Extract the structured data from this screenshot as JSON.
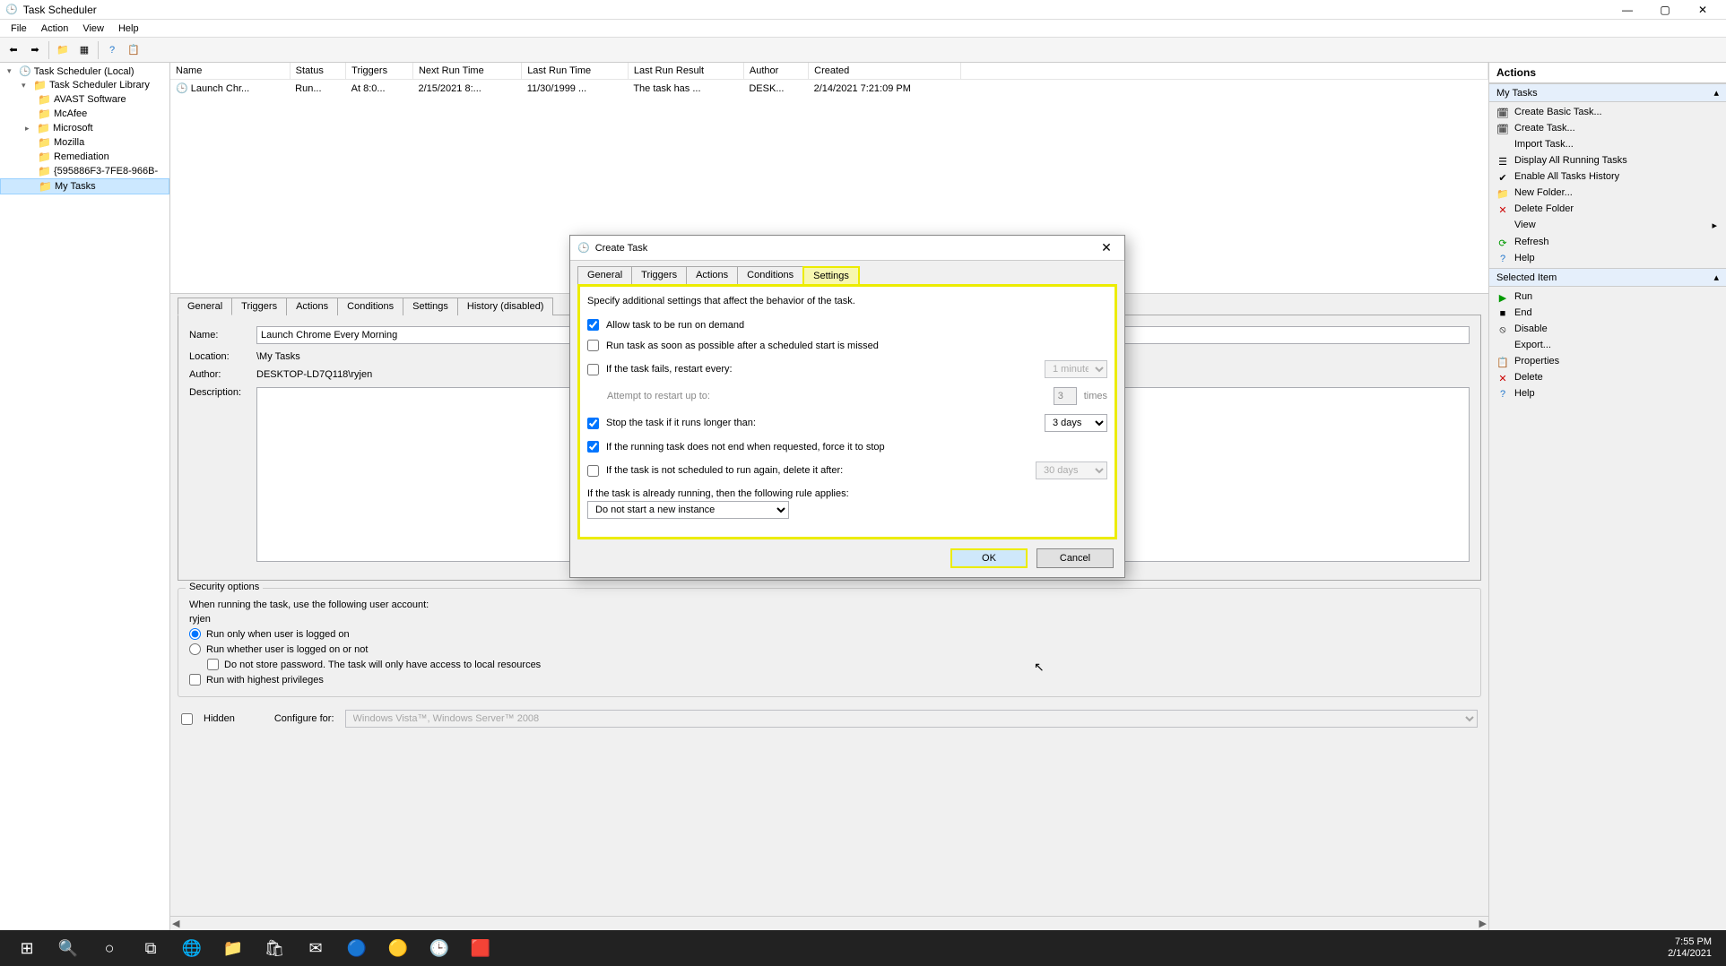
{
  "window": {
    "title": "Task Scheduler",
    "min": "—",
    "max": "▢",
    "close": "✕"
  },
  "menu": [
    "File",
    "Action",
    "View",
    "Help"
  ],
  "tree": {
    "root": "Task Scheduler (Local)",
    "lib": "Task Scheduler Library",
    "items": [
      "AVAST Software",
      "McAfee",
      "Microsoft",
      "Mozilla",
      "Remediation",
      "{595886F3-7FE8-966B-",
      "My Tasks"
    ]
  },
  "task_table": {
    "headers": [
      "Name",
      "Status",
      "Triggers",
      "Next Run Time",
      "Last Run Time",
      "Last Run Result",
      "Author",
      "Created"
    ],
    "row": [
      "Launch Chr...",
      "Run...",
      "At 8:0...",
      "2/15/2021 8:...",
      "11/30/1999 ...",
      "The task has ...",
      "DESK...",
      "2/14/2021 7:21:09 PM"
    ]
  },
  "detail_tabs": [
    "General",
    "Triggers",
    "Actions",
    "Conditions",
    "Settings",
    "History (disabled)"
  ],
  "detail": {
    "name_label": "Name:",
    "name_value": "Launch Chrome Every Morning",
    "location_label": "Location:",
    "location_value": "\\My Tasks",
    "author_label": "Author:",
    "author_value": "DESKTOP-LD7Q118\\ryjen",
    "description_label": "Description:"
  },
  "security": {
    "legend": "Security options",
    "line1": "When running the task, use the following user account:",
    "user": "ryjen",
    "opt1": "Run only when user is logged on",
    "opt2": "Run whether user is logged on or not",
    "opt3": "Do not store password.  The task will only have access to local resources",
    "opt4": "Run with highest privileges",
    "hidden": "Hidden",
    "configure_label": "Configure for:",
    "configure_value": "Windows Vista™, Windows Server™ 2008"
  },
  "actions": {
    "header": "Actions",
    "section1": "My Tasks",
    "list1": [
      "Create Basic Task...",
      "Create Task...",
      "Import Task...",
      "Display All Running Tasks",
      "Enable All Tasks History",
      "New Folder...",
      "Delete Folder",
      "View",
      "Refresh",
      "Help"
    ],
    "section2": "Selected Item",
    "list2": [
      "Run",
      "End",
      "Disable",
      "Export...",
      "Properties",
      "Delete",
      "Help"
    ]
  },
  "dialog": {
    "title": "Create Task",
    "tabs": [
      "General",
      "Triggers",
      "Actions",
      "Conditions",
      "Settings"
    ],
    "desc": "Specify additional settings that affect the behavior of the task.",
    "opt_allow": "Allow task to be run on demand",
    "opt_runasap": "Run task as soon as possible after a scheduled start is missed",
    "opt_restart": "If the task fails, restart every:",
    "restart_val": "1 minute",
    "attempt_label": "Attempt to restart up to:",
    "attempt_val": "3",
    "attempt_times": "times",
    "opt_stop": "Stop the task if it runs longer than:",
    "stop_val": "3 days",
    "opt_force": "If the running task does not end when requested, force it to stop",
    "opt_delete": "If the task is not scheduled to run again, delete it after:",
    "delete_val": "30 days",
    "rule_label": "If the task is already running, then the following rule applies:",
    "rule_val": "Do not start a new instance",
    "ok": "OK",
    "cancel": "Cancel"
  },
  "taskbar": {
    "time": "7:55 PM",
    "date": "2/14/2021"
  }
}
